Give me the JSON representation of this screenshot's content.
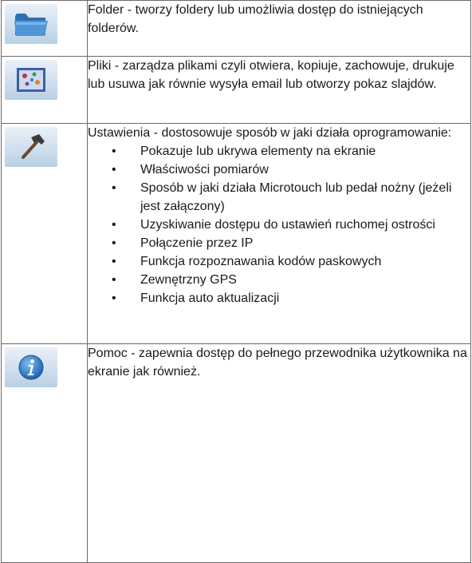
{
  "rows": [
    {
      "icon": "folder-icon",
      "text": "Folder - tworzy foldery lub umożliwia dostęp do istniejących folderów."
    },
    {
      "icon": "image-file-icon",
      "text": "Pliki - zarządza plikami czyli otwiera, kopiuje, zachowuje, drukuje lub usuwa jak równie wysyła email lub otworzy pokaz slajdów."
    },
    {
      "icon": "hammer-icon",
      "text": "Ustawienia - dostosowuje sposób w jaki działa oprogramowanie:",
      "items": [
        "Pokazuje lub ukrywa elementy na ekranie",
        "Właściwości pomiarów",
        "Sposób w jaki działa Microtouch lub pedał nożny (jeżeli jest załączony)",
        "Uzyskiwanie dostępu do ustawień ruchomej ostrości",
        "Połączenie przez IP",
        "Funkcja rozpoznawania kodów paskowych",
        "Zewnętrzny GPS",
        "Funkcja auto aktualizacji"
      ]
    },
    {
      "icon": "info-icon",
      "text": "Pomoc - zapewnia dostęp do pełnego przewodnika użytkownika na ekranie jak również."
    }
  ]
}
